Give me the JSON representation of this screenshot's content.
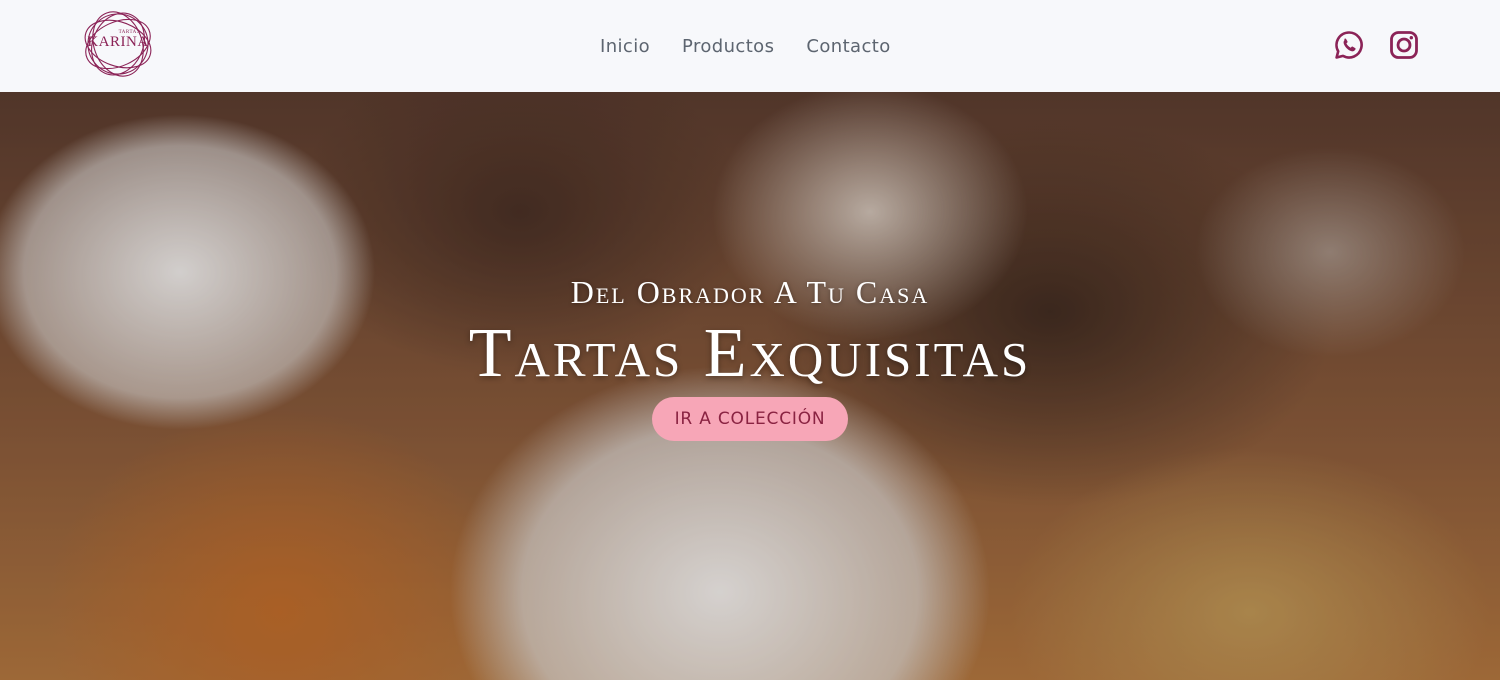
{
  "header": {
    "logo": {
      "brand": "KARINA",
      "small": "TARTAS"
    },
    "nav": [
      {
        "label": "Inicio"
      },
      {
        "label": "Productos"
      },
      {
        "label": "Contacto"
      }
    ],
    "social": [
      {
        "icon": "whatsapp-icon"
      },
      {
        "icon": "instagram-icon"
      }
    ]
  },
  "hero": {
    "subtitle": "Del Obrador A Tu Casa",
    "title": "Tartas Exquisitas",
    "button_label": "IR A COLECCIÓN"
  },
  "colors": {
    "accent": "#8b2357",
    "button": "#f7a6b7",
    "nav_text": "#5d6570",
    "header_bg": "#f7f8fb"
  }
}
